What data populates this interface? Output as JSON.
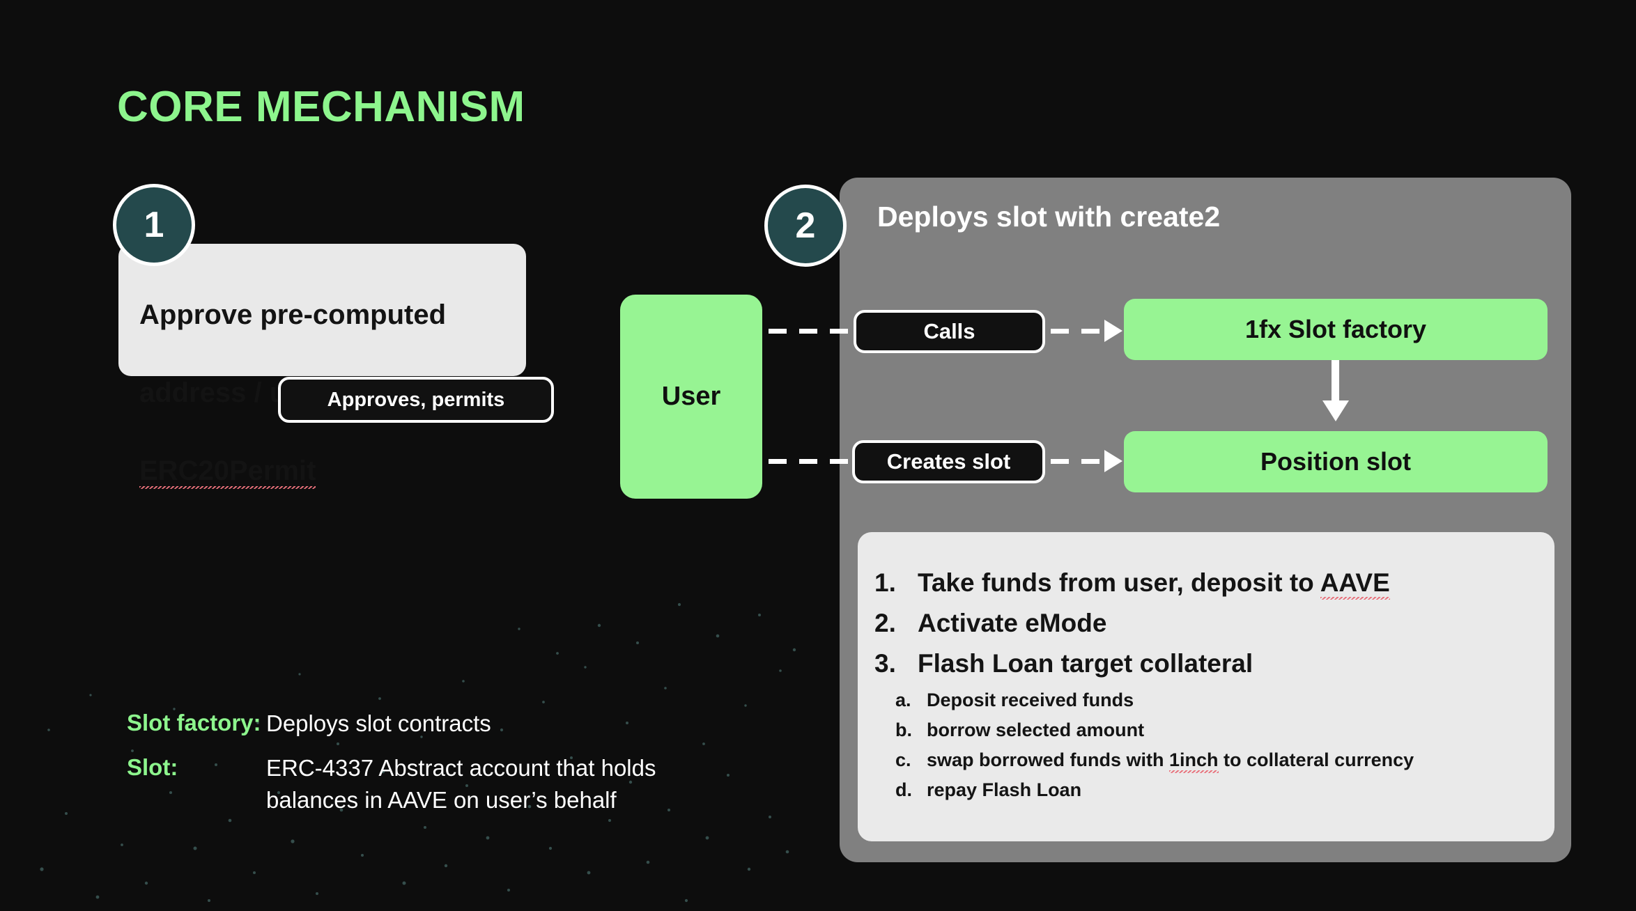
{
  "slide": {
    "title": "CORE MECHANISM",
    "background_color": "#0d0d0d",
    "accent_color": "#8df58d",
    "panel_color": "#808080",
    "box_green": "#97f493",
    "badge_color": "#24494c"
  },
  "step1": {
    "badge": "1",
    "text_line1": "Approve pre-computed",
    "text_line2": "address / uses",
    "text_line3": "ERC20Permit",
    "pill_label": "Approves, permits"
  },
  "step2": {
    "badge": "2",
    "title": "Deploys slot with create2",
    "user_box": "User",
    "pill_calls": "Calls",
    "pill_creates": "Creates slot",
    "box_factory": "1fx Slot factory",
    "box_position": "Position slot",
    "steps": [
      {
        "marker": "1.",
        "text": "Take funds from user, deposit to AAVE"
      },
      {
        "marker": "2.",
        "text": "Activate eMode"
      },
      {
        "marker": "3.",
        "text": "Flash Loan target collateral"
      }
    ],
    "substeps": [
      {
        "marker": "a.",
        "text": "Deposit received funds"
      },
      {
        "marker": "b.",
        "text": "borrow selected amount"
      },
      {
        "marker": "c.",
        "text": "swap borrowed funds with 1inch to collateral currency"
      },
      {
        "marker": "d.",
        "text": "repay Flash Loan"
      }
    ]
  },
  "legend": [
    {
      "key": "Slot factory:",
      "value": "Deploys slot contracts"
    },
    {
      "key": "Slot:",
      "value": "ERC-4337 Abstract account that holds balances in AAVE on user’s behalf"
    }
  ]
}
